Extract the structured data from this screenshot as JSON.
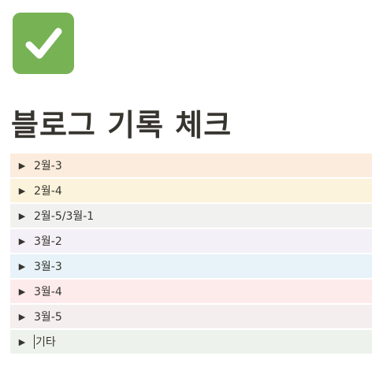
{
  "page": {
    "icon": "green-checkmark-icon",
    "icon_color": "#77b255",
    "title": "블로그 기록 체크"
  },
  "toggles": [
    {
      "label": "2월-3",
      "bg": "#fbecdd"
    },
    {
      "label": "2월-4",
      "bg": "#fbf3db"
    },
    {
      "label": "2월-5/3월-1",
      "bg": "#f1f1ef"
    },
    {
      "label": "3월-2",
      "bg": "#f4f0f7"
    },
    {
      "label": "3월-3",
      "bg": "#e7f3f8"
    },
    {
      "label": "3월-4",
      "bg": "#fdebec"
    },
    {
      "label": "3월-5",
      "bg": "#f4eeee"
    },
    {
      "label": "기타",
      "bg": "#edf3ec"
    }
  ],
  "arrow_glyph": "▶"
}
